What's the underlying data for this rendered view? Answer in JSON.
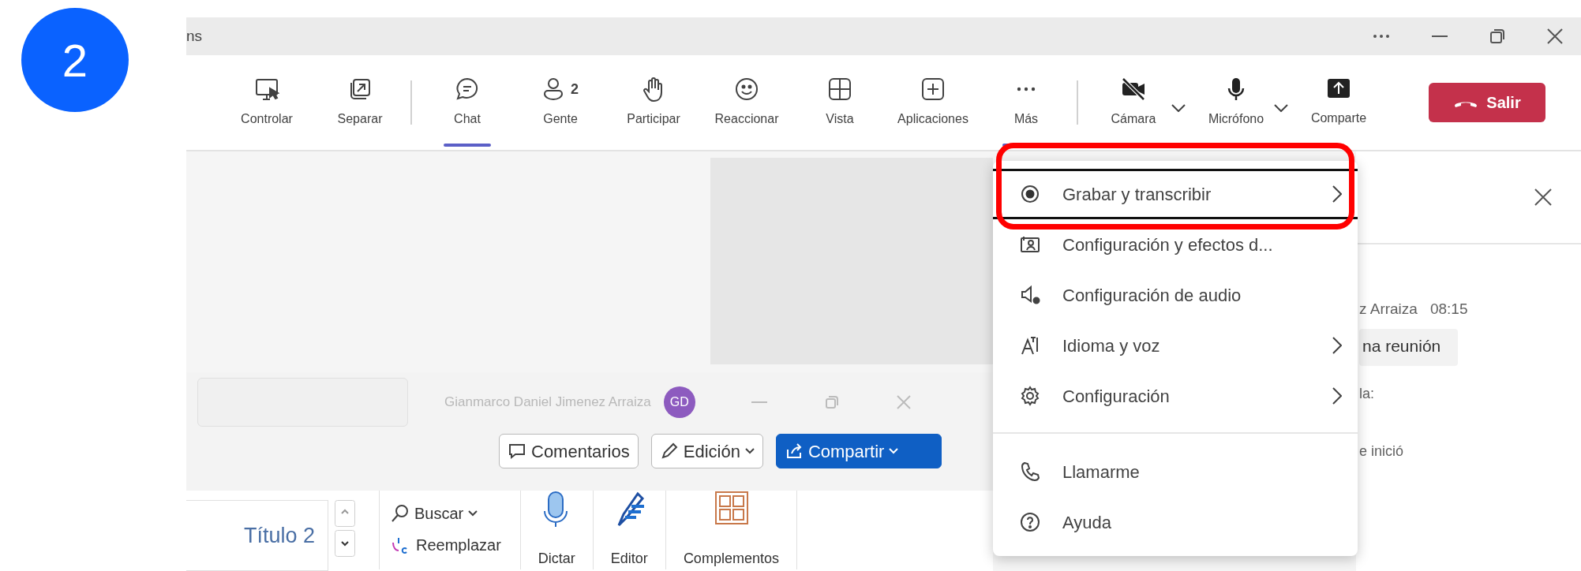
{
  "step_badge": "2",
  "window": {
    "title": "ns"
  },
  "toolbar": {
    "tool_groups": [
      [
        {
          "label": "Controlar",
          "selected": false
        },
        {
          "label": "Separar",
          "selected": false
        }
      ],
      [
        {
          "label": "Chat",
          "selected": true
        },
        {
          "label": "Gente",
          "count": "2",
          "selected": false
        },
        {
          "label": "Participar",
          "selected": false
        },
        {
          "label": "Reaccionar",
          "selected": false
        },
        {
          "label": "Vista",
          "selected": false
        },
        {
          "label": "Aplicaciones",
          "selected": false
        },
        {
          "label": "Más",
          "selected": true
        }
      ]
    ],
    "devices": [
      {
        "label": "Cámara",
        "on": false
      },
      {
        "label": "Micrófono",
        "on": true
      }
    ],
    "share_label": "Comparte",
    "leave_button": "Salir"
  },
  "menu": {
    "groups": [
      [
        {
          "label": "Grabar y transcribir",
          "submenu": true,
          "selected": true,
          "highlighted": true
        },
        {
          "label": "Configuración y efectos d...",
          "submenu": false,
          "selected": false,
          "highlighted": false
        },
        {
          "label": "Configuración de audio",
          "submenu": false,
          "selected": false,
          "highlighted": false
        },
        {
          "label": "Idioma y voz",
          "submenu": true,
          "selected": false,
          "highlighted": false
        },
        {
          "label": "Configuración",
          "submenu": true,
          "selected": false,
          "highlighted": false
        }
      ],
      [
        {
          "label": "Llamarme",
          "submenu": false,
          "selected": false,
          "highlighted": false
        },
        {
          "label": "Ayuda",
          "submenu": false,
          "selected": false,
          "highlighted": false
        }
      ]
    ]
  },
  "chat_panel": {
    "sender": "z Arraiza",
    "time": "08:15",
    "message": "na reunión",
    "lines": [
      "la:",
      "e inició"
    ]
  },
  "word_window": {
    "user_name": "Gianmarco Daniel Jimenez Arraiza",
    "avatar": "GD",
    "buttons": [
      {
        "label": "Comentarios",
        "kind": "comment"
      },
      {
        "label": "Edición",
        "kind": "edit"
      },
      {
        "label": "Compartir",
        "kind": "share"
      }
    ],
    "style": "Título 2",
    "find": "Buscar",
    "replace": "Reemplazar",
    "ribbon_buttons": [
      "Dictar",
      "Editor",
      "Complementos"
    ]
  }
}
